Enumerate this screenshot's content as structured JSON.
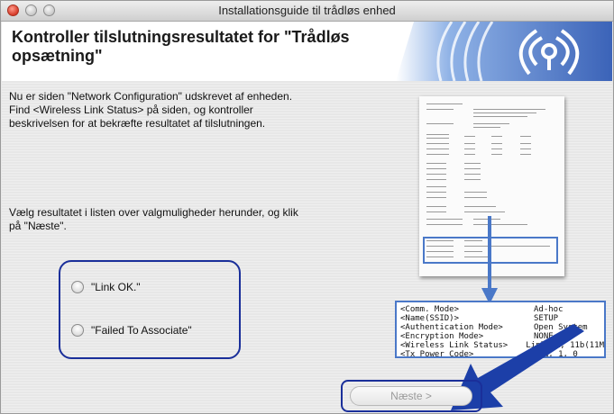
{
  "window": {
    "title": "Installationsguide til trådløs enhed"
  },
  "banner": {
    "title_line1": "Kontroller tilslutningsresultatet for \"Trådløs",
    "title_line2": "opsætning\"",
    "logo_icon": "wireless-signal-icon"
  },
  "instructions": {
    "para1_line1": "Nu er siden \"Network Configuration\" udskrevet af enheden.",
    "para1_line2": "Find <Wireless Link Status> på siden, og kontroller",
    "para1_line3": "beskrivelsen for at bekræfte resultatet af tilslutningen.",
    "para2_line1": "Vælg resultatet i listen over valgmuligheder herunder, og klik",
    "para2_line2": "på \"Næste\"."
  },
  "options": [
    {
      "label": "\"Link OK.\"",
      "selected": false
    },
    {
      "label": "\"Failed To Associate\"",
      "selected": false
    }
  ],
  "zoom_box": {
    "rows": [
      {
        "key": "<Comm. Mode>",
        "value": "Ad-hoc"
      },
      {
        "key": "<Name(SSID)>",
        "value": "SETUP"
      },
      {
        "key": "<Authentication Mode>",
        "value": "Open System"
      },
      {
        "key": "<Encryption Mode>",
        "value": "NONE"
      },
      {
        "key": "<Wireless Link Status>",
        "value": "Link OK, 11b(11M"
      },
      {
        "key": "<Tx Power Code>",
        "value": "JPN, 1, 0"
      }
    ]
  },
  "footer": {
    "next_label": "Næste >",
    "next_enabled": false
  },
  "colors": {
    "highlight_ring": "#1a2f9a",
    "arrow": "#1c3fa8",
    "accent_box": "#4a78c8"
  }
}
